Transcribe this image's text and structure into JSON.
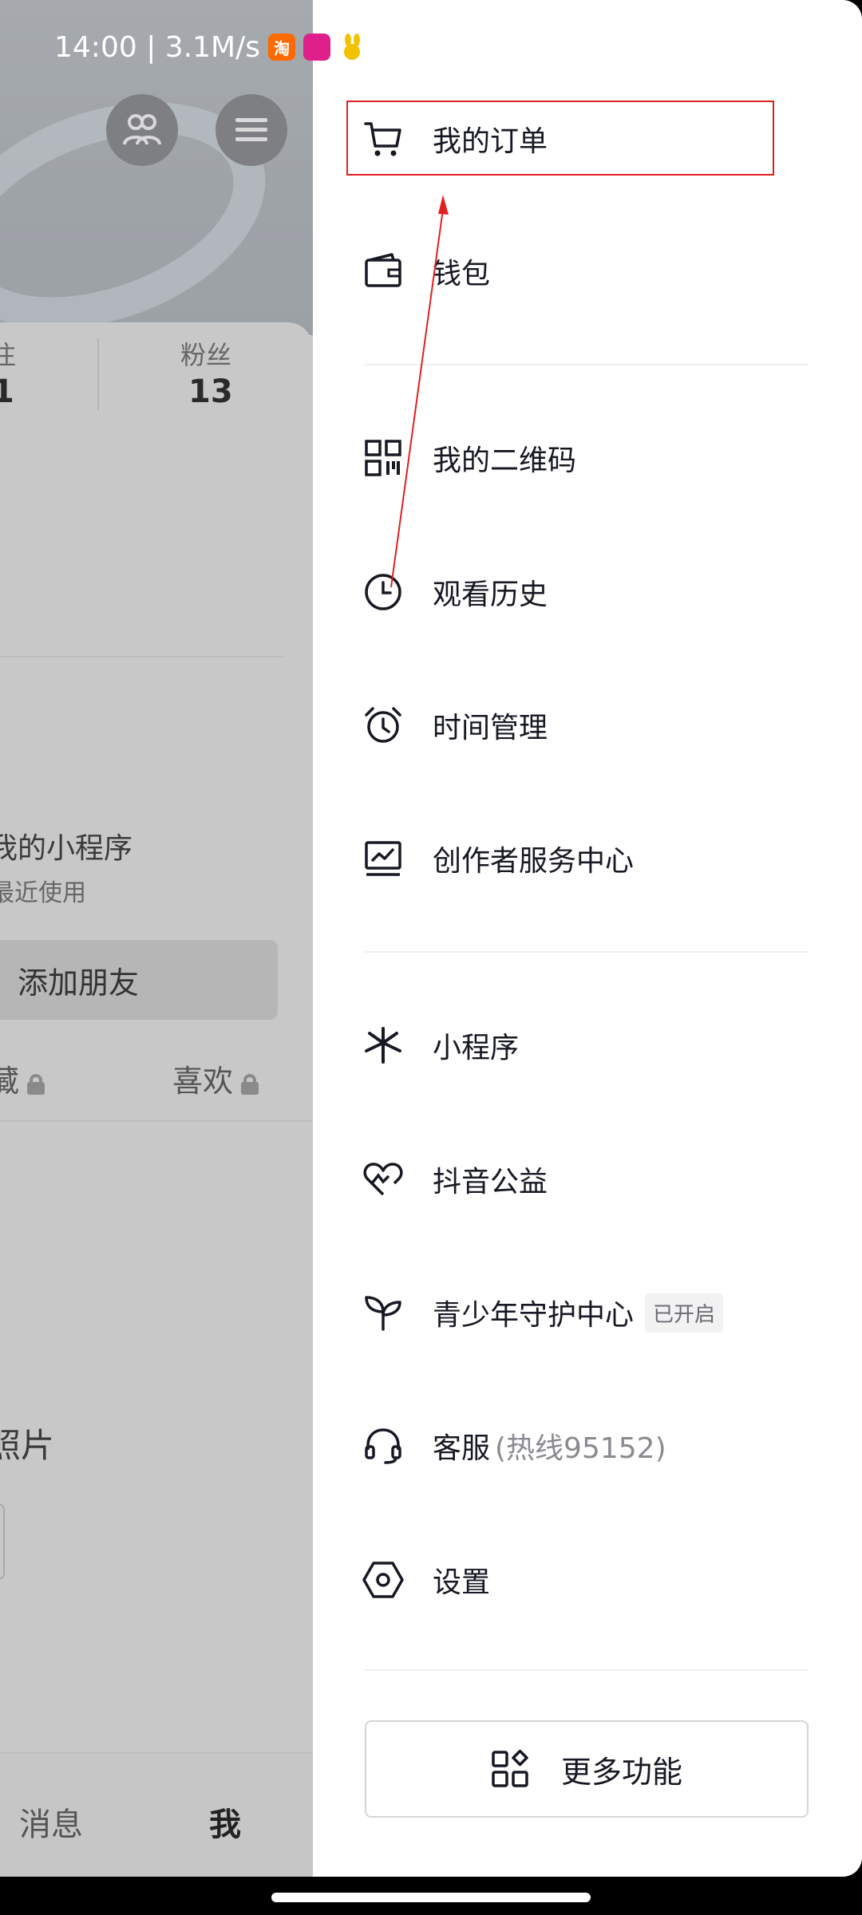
{
  "status_bar": {
    "time_speed": "14:00 | 3.1M/s",
    "badges": [
      {
        "icon": "taobao-icon",
        "text": "淘",
        "color": "#ff6a00"
      },
      {
        "icon": "app-pink-icon",
        "text": "",
        "color": "#e0208a"
      },
      {
        "icon": "rabbit-icon",
        "text": "",
        "color": "#f2c200"
      }
    ]
  },
  "background_profile": {
    "stats": [
      {
        "label": "注",
        "value": "1"
      },
      {
        "label": "粉丝",
        "value": "13"
      }
    ],
    "mini_program_title": "我的小程序",
    "mini_program_sub": "最近使用",
    "add_friend_label": "添加朋友",
    "tabs": [
      {
        "label": "藏",
        "locked": true
      },
      {
        "label": "喜欢",
        "locked": true
      }
    ],
    "photo_label": "照片",
    "bottom_nav": [
      "消息",
      "我"
    ]
  },
  "drawer": {
    "items": [
      {
        "label": "我的订单",
        "icon": "cart-icon"
      },
      {
        "label": "钱包",
        "icon": "wallet-icon"
      },
      {
        "label": "我的二维码",
        "icon": "qrcode-icon"
      },
      {
        "label": "观看历史",
        "icon": "clock-icon"
      },
      {
        "label": "时间管理",
        "icon": "alarm-icon"
      },
      {
        "label": "创作者服务中心",
        "icon": "chart-monitor-icon"
      },
      {
        "label": "小程序",
        "icon": "mini-program-icon"
      },
      {
        "label": "抖音公益",
        "icon": "heart-charity-icon"
      },
      {
        "label": "青少年守护中心",
        "icon": "sprout-icon",
        "badge": "已开启"
      },
      {
        "label": "客服",
        "icon": "headset-icon",
        "extra": "(热线95152)"
      },
      {
        "label": "设置",
        "icon": "settings-hex-icon"
      }
    ],
    "more_button": {
      "label": "更多功能",
      "icon": "apps-grid-icon"
    }
  },
  "annotation": {
    "highlight_color": "#e02020",
    "target": "我的订单"
  }
}
